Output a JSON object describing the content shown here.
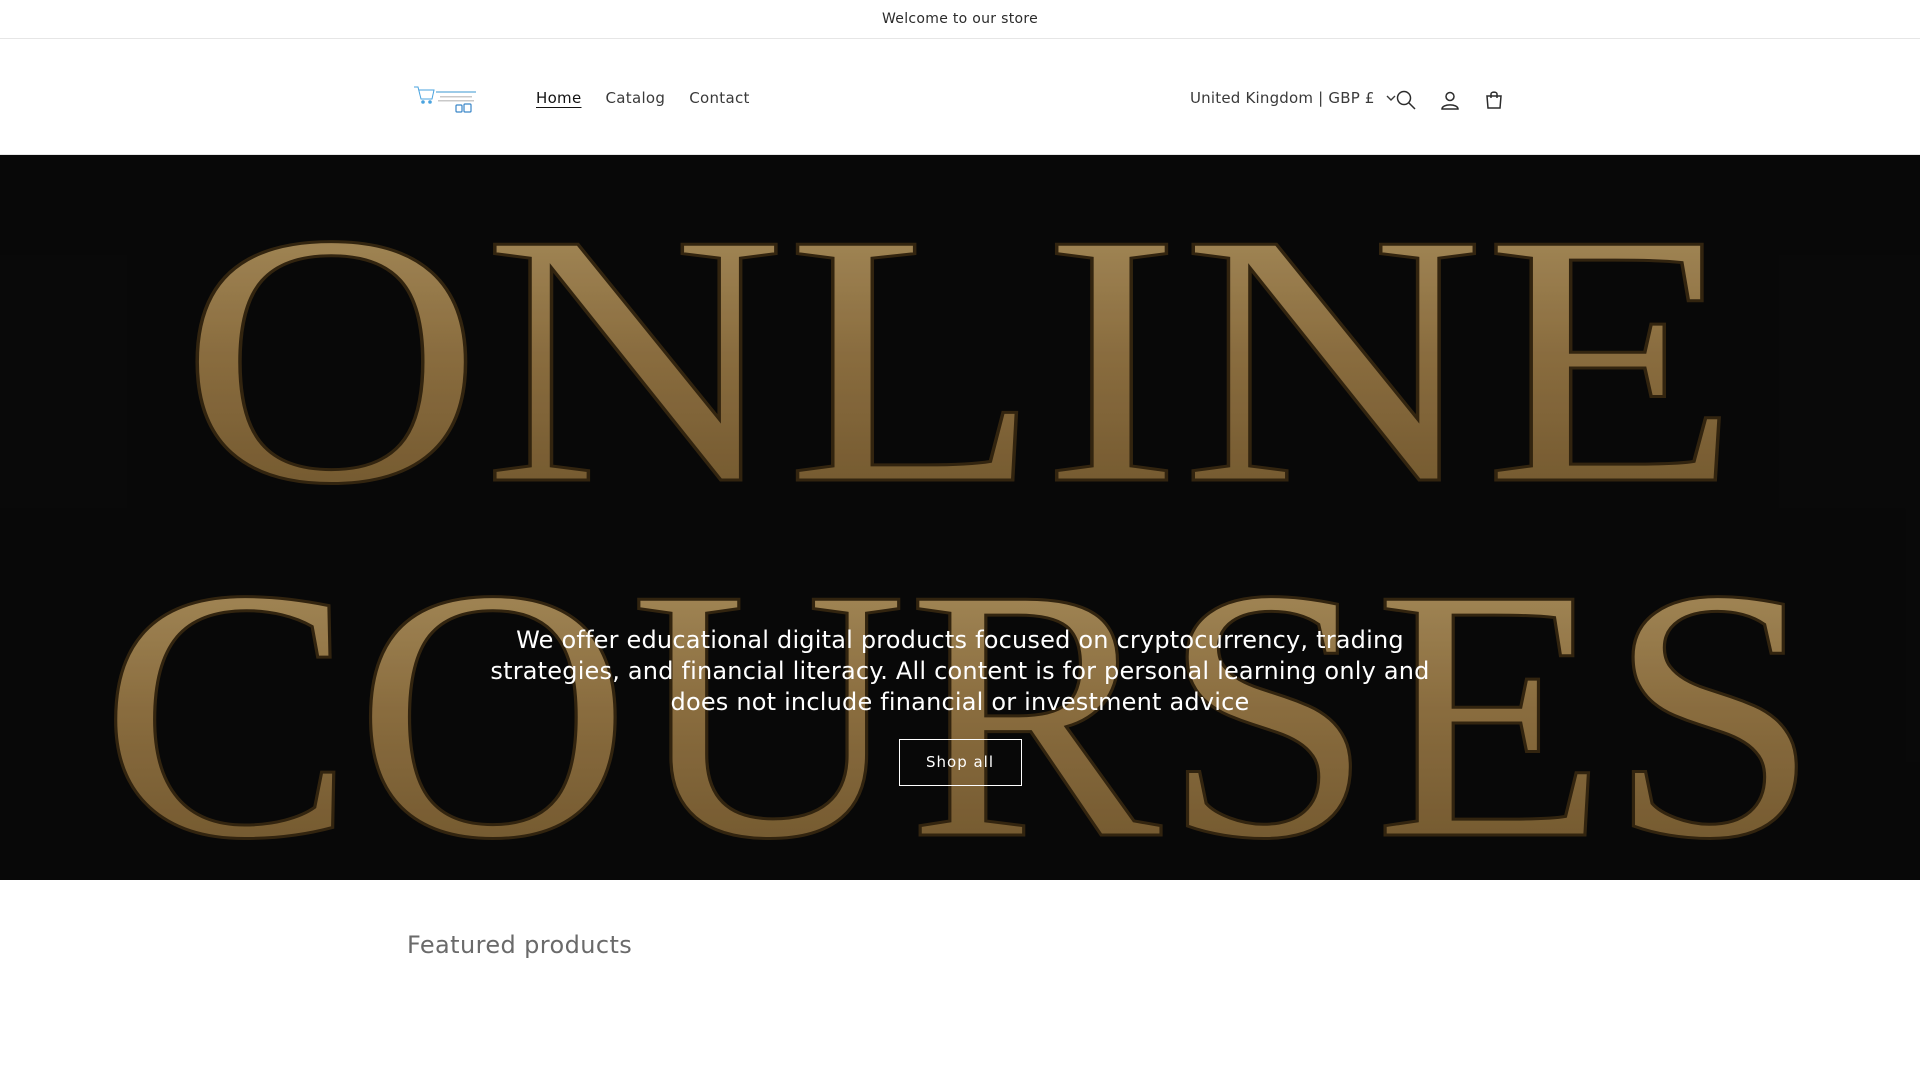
{
  "announcement": {
    "text": "Welcome to our store"
  },
  "header": {
    "logo_alt": "store logo",
    "nav": [
      {
        "label": "Home",
        "active": true
      },
      {
        "label": "Catalog",
        "active": false
      },
      {
        "label": "Contact",
        "active": false
      }
    ],
    "locale": "United Kingdom | GBP £",
    "icons": [
      "search-icon",
      "account-icon",
      "cart-icon"
    ]
  },
  "hero": {
    "image_text_line1": "ONLINE",
    "image_text_line2": "COURSES",
    "text": "We offer educational digital products focused on cryptocurrency, trading strategies, and financial literacy. All content is for personal learning only and does not include financial or investment advice",
    "button_label": "Shop all",
    "gold_color": "#a8874e",
    "background_color": "#0a0a0a"
  },
  "featured": {
    "heading": "Featured products"
  }
}
